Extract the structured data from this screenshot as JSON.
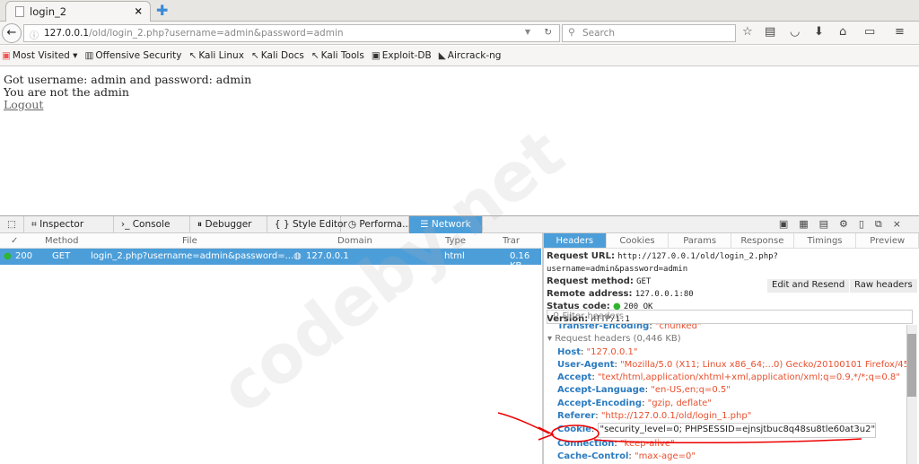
{
  "browser": {
    "tab_title": "login_2",
    "url_host": "127.0.0.1",
    "url_path": "/old/login_2.php?username=admin&password=admin",
    "search_placeholder": "Search"
  },
  "bookmarks": [
    "Most Visited",
    "Offensive Security",
    "Kali Linux",
    "Kali Docs",
    "Kali Tools",
    "Exploit-DB",
    "Aircrack-ng"
  ],
  "page": {
    "line1": "Got username: admin and password: admin",
    "line2": "You are not the admin",
    "logout": "Logout"
  },
  "devtools": {
    "tabs": [
      "Inspector",
      "Console",
      "Debugger",
      "Style Editor",
      "Performa...",
      "Network"
    ],
    "columns": [
      "✓",
      "Method",
      "File",
      "Domain",
      "Type",
      "Trar"
    ],
    "request": {
      "status": "200",
      "method": "GET",
      "file": "login_2.php?username=admin&password=...",
      "domain": "127.0.0.1",
      "type": "html",
      "size": "0.16 KB"
    },
    "detail_tabs": [
      "Headers",
      "Cookies",
      "Params",
      "Response",
      "Timings",
      "Preview"
    ],
    "summary": {
      "url_label": "Request URL:",
      "url": "http://127.0.0.1/old/login_2.php?username=admin&password=admin",
      "method_label": "Request method:",
      "method": "GET",
      "remote_label": "Remote address:",
      "remote": "127.0.0.1:80",
      "status_label": "Status code:",
      "status": "200 OK",
      "version_label": "Version:",
      "version": "HTTP/1.1"
    },
    "edit_resend": "Edit and Resend",
    "raw_headers": "Raw headers",
    "filter_placeholder": "Filter headers",
    "prev_header": {
      "k": "Transfer-Encoding",
      "v": "\"chunked\""
    },
    "group": "Request headers (0,446 KB)",
    "headers": [
      {
        "k": "Host",
        "v": "\"127.0.0.1\""
      },
      {
        "k": "User-Agent",
        "v": "\"Mozilla/5.0 (X11; Linux x86_64;...0) Gecko/20100101 Firefox/45.0\""
      },
      {
        "k": "Accept",
        "v": "\"text/html,application/xhtml+xml,application/xml;q=0.9,*/*;q=0.8\""
      },
      {
        "k": "Accept-Language",
        "v": "\"en-US,en;q=0.5\""
      },
      {
        "k": "Accept-Encoding",
        "v": "\"gzip, deflate\""
      },
      {
        "k": "Referer",
        "v": "\"http://127.0.0.1/old/login_1.php\""
      },
      {
        "k": "Cookie",
        "v": "\"security_level=0; PHPSESSID=ejnsjtbuc8q48su8tle60at3u2\""
      },
      {
        "k": "Connection",
        "v": "\"keep-alive\""
      },
      {
        "k": "Cache-Control",
        "v": "\"max-age=0\""
      }
    ]
  },
  "watermark": "codeby.net",
  "colors": {
    "accent": "#4c9ed9",
    "header_key": "#2b7bc0",
    "header_value": "#e8502e",
    "annotation": "#e00000",
    "status_ok": "#2fb52f"
  }
}
